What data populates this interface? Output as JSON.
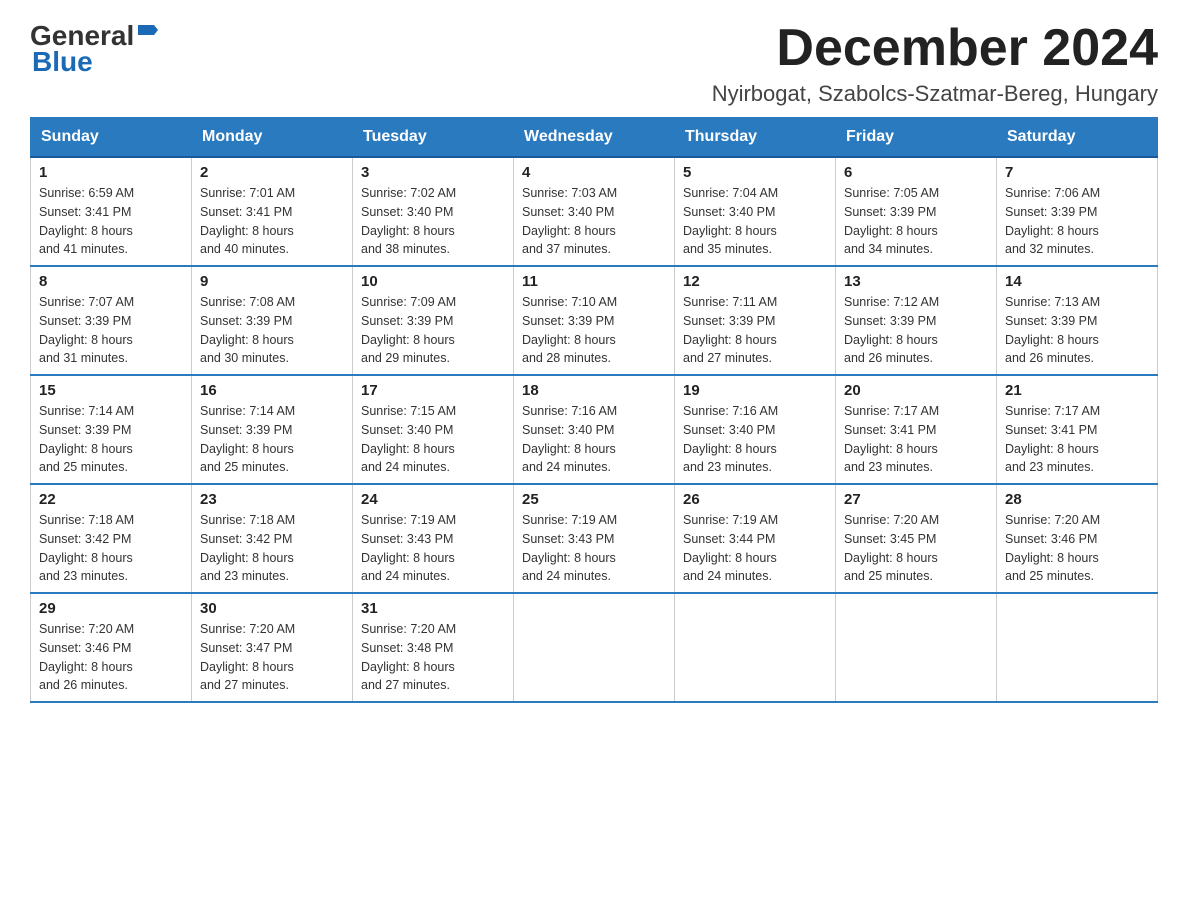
{
  "logo": {
    "general": "General",
    "blue": "Blue"
  },
  "title": {
    "month": "December 2024",
    "location": "Nyirbogat, Szabolcs-Szatmar-Bereg, Hungary"
  },
  "weekdays": [
    "Sunday",
    "Monday",
    "Tuesday",
    "Wednesday",
    "Thursday",
    "Friday",
    "Saturday"
  ],
  "weeks": [
    [
      {
        "day": "1",
        "sunrise": "6:59 AM",
        "sunset": "3:41 PM",
        "daylight": "8 hours and 41 minutes."
      },
      {
        "day": "2",
        "sunrise": "7:01 AM",
        "sunset": "3:41 PM",
        "daylight": "8 hours and 40 minutes."
      },
      {
        "day": "3",
        "sunrise": "7:02 AM",
        "sunset": "3:40 PM",
        "daylight": "8 hours and 38 minutes."
      },
      {
        "day": "4",
        "sunrise": "7:03 AM",
        "sunset": "3:40 PM",
        "daylight": "8 hours and 37 minutes."
      },
      {
        "day": "5",
        "sunrise": "7:04 AM",
        "sunset": "3:40 PM",
        "daylight": "8 hours and 35 minutes."
      },
      {
        "day": "6",
        "sunrise": "7:05 AM",
        "sunset": "3:39 PM",
        "daylight": "8 hours and 34 minutes."
      },
      {
        "day": "7",
        "sunrise": "7:06 AM",
        "sunset": "3:39 PM",
        "daylight": "8 hours and 32 minutes."
      }
    ],
    [
      {
        "day": "8",
        "sunrise": "7:07 AM",
        "sunset": "3:39 PM",
        "daylight": "8 hours and 31 minutes."
      },
      {
        "day": "9",
        "sunrise": "7:08 AM",
        "sunset": "3:39 PM",
        "daylight": "8 hours and 30 minutes."
      },
      {
        "day": "10",
        "sunrise": "7:09 AM",
        "sunset": "3:39 PM",
        "daylight": "8 hours and 29 minutes."
      },
      {
        "day": "11",
        "sunrise": "7:10 AM",
        "sunset": "3:39 PM",
        "daylight": "8 hours and 28 minutes."
      },
      {
        "day": "12",
        "sunrise": "7:11 AM",
        "sunset": "3:39 PM",
        "daylight": "8 hours and 27 minutes."
      },
      {
        "day": "13",
        "sunrise": "7:12 AM",
        "sunset": "3:39 PM",
        "daylight": "8 hours and 26 minutes."
      },
      {
        "day": "14",
        "sunrise": "7:13 AM",
        "sunset": "3:39 PM",
        "daylight": "8 hours and 26 minutes."
      }
    ],
    [
      {
        "day": "15",
        "sunrise": "7:14 AM",
        "sunset": "3:39 PM",
        "daylight": "8 hours and 25 minutes."
      },
      {
        "day": "16",
        "sunrise": "7:14 AM",
        "sunset": "3:39 PM",
        "daylight": "8 hours and 25 minutes."
      },
      {
        "day": "17",
        "sunrise": "7:15 AM",
        "sunset": "3:40 PM",
        "daylight": "8 hours and 24 minutes."
      },
      {
        "day": "18",
        "sunrise": "7:16 AM",
        "sunset": "3:40 PM",
        "daylight": "8 hours and 24 minutes."
      },
      {
        "day": "19",
        "sunrise": "7:16 AM",
        "sunset": "3:40 PM",
        "daylight": "8 hours and 23 minutes."
      },
      {
        "day": "20",
        "sunrise": "7:17 AM",
        "sunset": "3:41 PM",
        "daylight": "8 hours and 23 minutes."
      },
      {
        "day": "21",
        "sunrise": "7:17 AM",
        "sunset": "3:41 PM",
        "daylight": "8 hours and 23 minutes."
      }
    ],
    [
      {
        "day": "22",
        "sunrise": "7:18 AM",
        "sunset": "3:42 PM",
        "daylight": "8 hours and 23 minutes."
      },
      {
        "day": "23",
        "sunrise": "7:18 AM",
        "sunset": "3:42 PM",
        "daylight": "8 hours and 23 minutes."
      },
      {
        "day": "24",
        "sunrise": "7:19 AM",
        "sunset": "3:43 PM",
        "daylight": "8 hours and 24 minutes."
      },
      {
        "day": "25",
        "sunrise": "7:19 AM",
        "sunset": "3:43 PM",
        "daylight": "8 hours and 24 minutes."
      },
      {
        "day": "26",
        "sunrise": "7:19 AM",
        "sunset": "3:44 PM",
        "daylight": "8 hours and 24 minutes."
      },
      {
        "day": "27",
        "sunrise": "7:20 AM",
        "sunset": "3:45 PM",
        "daylight": "8 hours and 25 minutes."
      },
      {
        "day": "28",
        "sunrise": "7:20 AM",
        "sunset": "3:46 PM",
        "daylight": "8 hours and 25 minutes."
      }
    ],
    [
      {
        "day": "29",
        "sunrise": "7:20 AM",
        "sunset": "3:46 PM",
        "daylight": "8 hours and 26 minutes."
      },
      {
        "day": "30",
        "sunrise": "7:20 AM",
        "sunset": "3:47 PM",
        "daylight": "8 hours and 27 minutes."
      },
      {
        "day": "31",
        "sunrise": "7:20 AM",
        "sunset": "3:48 PM",
        "daylight": "8 hours and 27 minutes."
      },
      null,
      null,
      null,
      null
    ]
  ],
  "labels": {
    "sunrise": "Sunrise:",
    "sunset": "Sunset:",
    "daylight": "Daylight:"
  }
}
